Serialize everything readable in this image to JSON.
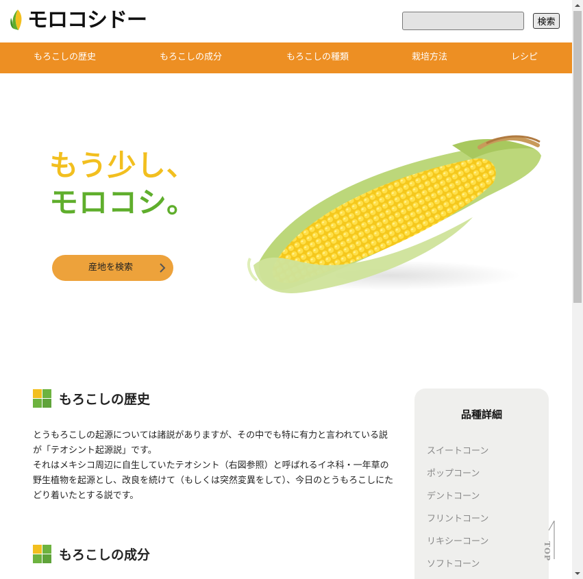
{
  "header": {
    "logo_text": "モロコシドー",
    "search_placeholder": "",
    "search_button": "検索"
  },
  "nav": {
    "items": [
      {
        "label": "もろこしの歴史"
      },
      {
        "label": "もろこしの成分"
      },
      {
        "label": "もろこしの種類"
      },
      {
        "label": "栽培方法"
      },
      {
        "label": "レシピ"
      }
    ]
  },
  "hero": {
    "catch_line1": "もう少し、",
    "catch_line2": "モロコシ。",
    "area_button": "産地を検索"
  },
  "sections": {
    "history_title": "もろこしの歴史",
    "history_p1": "とうもろこしの起源については諸説がありますが、その中でも特に有力と言われている説が「テオシント起源説」です。",
    "history_p2": "それはメキシコ周辺に自生していたテオシント（右図参照）と呼ばれるイネ科・一年草の野生植物を起源とし、改良を続けて（もしくは突然変異をして）、今日のとうもろこしにたどり着いたとする説です。",
    "components_title": "もろこしの成分"
  },
  "sidebar": {
    "title": "品種詳細",
    "items": [
      {
        "label": "スイートコーン"
      },
      {
        "label": "ポップコーン"
      },
      {
        "label": "デントコーン"
      },
      {
        "label": "フリントコーン"
      },
      {
        "label": "リキシーコーン"
      },
      {
        "label": "ソフトコーン"
      }
    ]
  },
  "to_top": "TOP",
  "colors": {
    "nav": "#ed8f23",
    "catch_yellow": "#f2bf1f",
    "catch_green": "#5fae2c",
    "area_button": "#eda23b"
  }
}
